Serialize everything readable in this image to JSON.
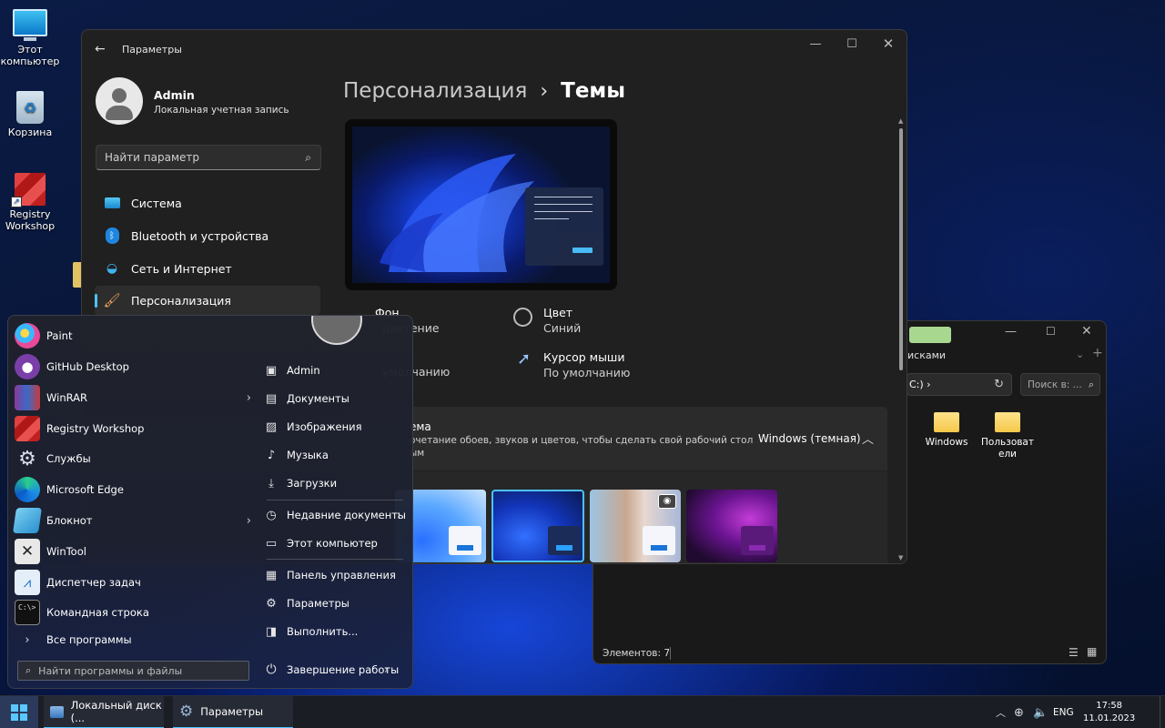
{
  "desktop_icons": [
    {
      "label_l1": "Этот",
      "label_l2": "компьютер",
      "icon": "monitor-icon"
    },
    {
      "label_l1": "Корзина",
      "label_l2": "",
      "icon": "recycle-bin-icon"
    },
    {
      "label_l1": "Registry",
      "label_l2": "Workshop",
      "icon": "registry-icon"
    }
  ],
  "settings": {
    "title": "Параметры",
    "user_name": "Admin",
    "user_sub": "Локальная учетная запись",
    "search_placeholder": "Найти параметр",
    "nav": [
      {
        "label": "Система",
        "icon": "display-icon"
      },
      {
        "label": "Bluetooth и устройства",
        "icon": "bluetooth-icon"
      },
      {
        "label": "Сеть и Интернет",
        "icon": "wifi-icon"
      },
      {
        "label": "Персонализация",
        "icon": "brush-icon"
      }
    ],
    "breadcrumb_parent": "Персонализация",
    "breadcrumb_sep": "›",
    "page_title": "Темы",
    "background": {
      "title": "Фон",
      "sub": "цветение"
    },
    "color": {
      "title": "Цвет",
      "sub": "Синий"
    },
    "sound_sub": "умолчанию",
    "cursor": {
      "title": "Курсор мыши",
      "sub": "По умолчанию"
    },
    "current_theme": {
      "title": "ема",
      "desc_l1": "очетание обоев, звуков и цветов, чтобы сделать свой рабочий стол",
      "desc_l2": "ым",
      "value": "Windows (темная)"
    }
  },
  "explorer": {
    "tab_label": "исками",
    "address_text": "C:) ›",
    "search_placeholder": "Поиск в: ...",
    "items": [
      {
        "label_l1": "Windows",
        "label_l2": ""
      },
      {
        "label_l1": "Пользоват",
        "label_l2": "ели"
      }
    ],
    "status": "Элементов: 7"
  },
  "start_menu": {
    "user_circle": "avatar",
    "apps": [
      {
        "label": "Paint",
        "icon": "paint-icon",
        "arrow": false
      },
      {
        "label": "GitHub Desktop",
        "icon": "github-icon",
        "arrow": false
      },
      {
        "label": "WinRAR",
        "icon": "winrar-icon",
        "arrow": true
      },
      {
        "label": "Registry Workshop",
        "icon": "registry-icon",
        "arrow": false
      },
      {
        "label": "Службы",
        "icon": "services-icon",
        "arrow": false
      },
      {
        "label": "Microsoft Edge",
        "icon": "edge-icon",
        "arrow": false
      },
      {
        "label": "Блокнот",
        "icon": "notepad-icon",
        "arrow": true
      },
      {
        "label": "WinTool",
        "icon": "wintool-icon",
        "arrow": false
      },
      {
        "label": "Диспетчер задач",
        "icon": "task-manager-icon",
        "arrow": false
      },
      {
        "label": "Командная строка",
        "icon": "cmd-icon",
        "arrow": false
      }
    ],
    "all_programs": "Все программы",
    "search_placeholder": "Найти программы и файлы",
    "places": [
      {
        "label": "Admin",
        "icon": "user-folder-icon",
        "glyph": "▣",
        "arrow": false
      },
      {
        "label": "Документы",
        "icon": "document-icon",
        "glyph": "▤",
        "arrow": false
      },
      {
        "label": "Изображения",
        "icon": "image-icon",
        "glyph": "▨",
        "arrow": false
      },
      {
        "label": "Музыка",
        "icon": "music-icon",
        "glyph": "♪",
        "arrow": false
      },
      {
        "label": "Загрузки",
        "icon": "download-icon",
        "glyph": "⤓",
        "arrow": false
      },
      {
        "label": "Недавние документы",
        "icon": "recent-icon",
        "glyph": "◷",
        "arrow": true
      },
      {
        "label": "Этот компьютер",
        "icon": "computer-icon",
        "glyph": "▭",
        "arrow": false
      },
      {
        "label": "Панель управления",
        "icon": "control-panel-icon",
        "glyph": "▦",
        "arrow": false
      },
      {
        "label": "Параметры",
        "icon": "gear-icon",
        "glyph": "⚙",
        "arrow": false
      },
      {
        "label": "Выполнить...",
        "icon": "run-icon",
        "glyph": "◨",
        "arrow": false
      }
    ],
    "shutdown": "Завершение работы"
  },
  "taskbar": {
    "items": [
      {
        "label": "Локальный диск (...",
        "icon": "explorer-icon"
      },
      {
        "label": "Параметры",
        "icon": "settings-gear-icon"
      }
    ],
    "lang": "ENG",
    "time": "17:58",
    "date": "11.01.2023"
  },
  "colors": {
    "accent": "#4cc2ff",
    "window_bg": "#202020",
    "start_bg": "#20222c"
  }
}
